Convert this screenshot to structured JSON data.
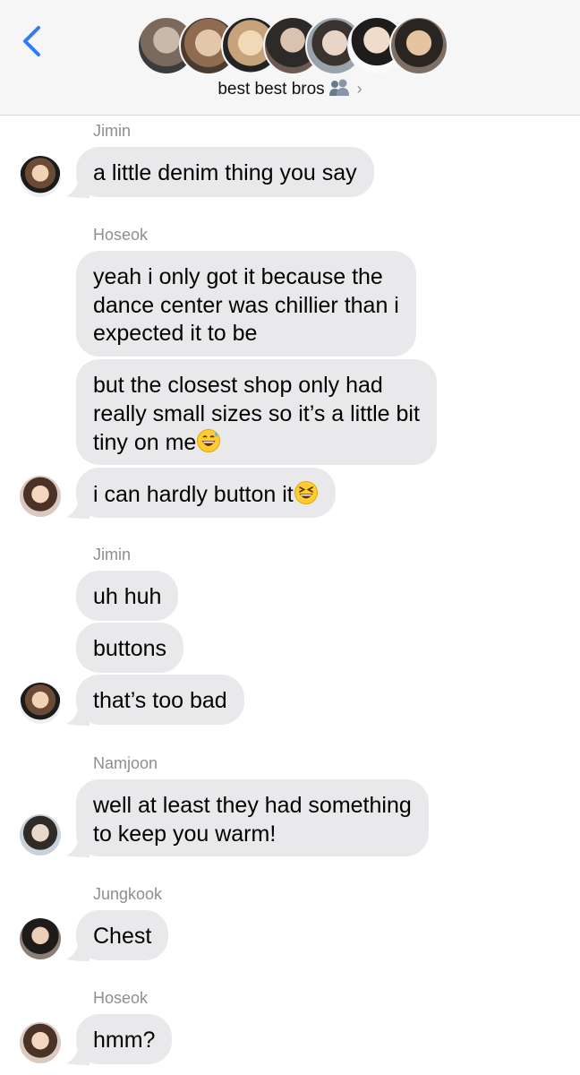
{
  "header": {
    "title": "best best bros",
    "title_icon": "two-people-icon",
    "chevron": "›",
    "back_icon": "chevron-left-icon",
    "accent": "#2f7cf6"
  },
  "messages": [
    {
      "sender": "Jimin",
      "text": "a little denim thing you say",
      "avatar": "jimin"
    },
    {
      "sender": "Hoseok",
      "text": "yeah i only got it because the\ndance center was chillier than i\nexpected it to be"
    },
    {
      "text": "but the closest shop only had\nreally small sizes so it’s a little bit\ntiny on me",
      "emoji": "grinning-sweat-emoji"
    },
    {
      "text": "i can hardly button it",
      "emoji": "laughing-squint-emoji",
      "avatar": "hoseok"
    },
    {
      "sender": "Jimin",
      "text": "uh huh"
    },
    {
      "text": "buttons"
    },
    {
      "text": "that’s too bad",
      "avatar": "jimin"
    },
    {
      "sender": "Namjoon",
      "text": "well at least they had something\nto keep you warm!",
      "avatar": "namjoon"
    },
    {
      "sender": "Jungkook",
      "text": "Chest",
      "avatar": "jungkook"
    },
    {
      "sender": "Hoseok",
      "text": "hmm?",
      "avatar": "hoseok"
    }
  ],
  "colors": {
    "bubble": "#e9e9eb",
    "sender_text": "#8e8e93",
    "header_bg": "#f6f6f6"
  }
}
